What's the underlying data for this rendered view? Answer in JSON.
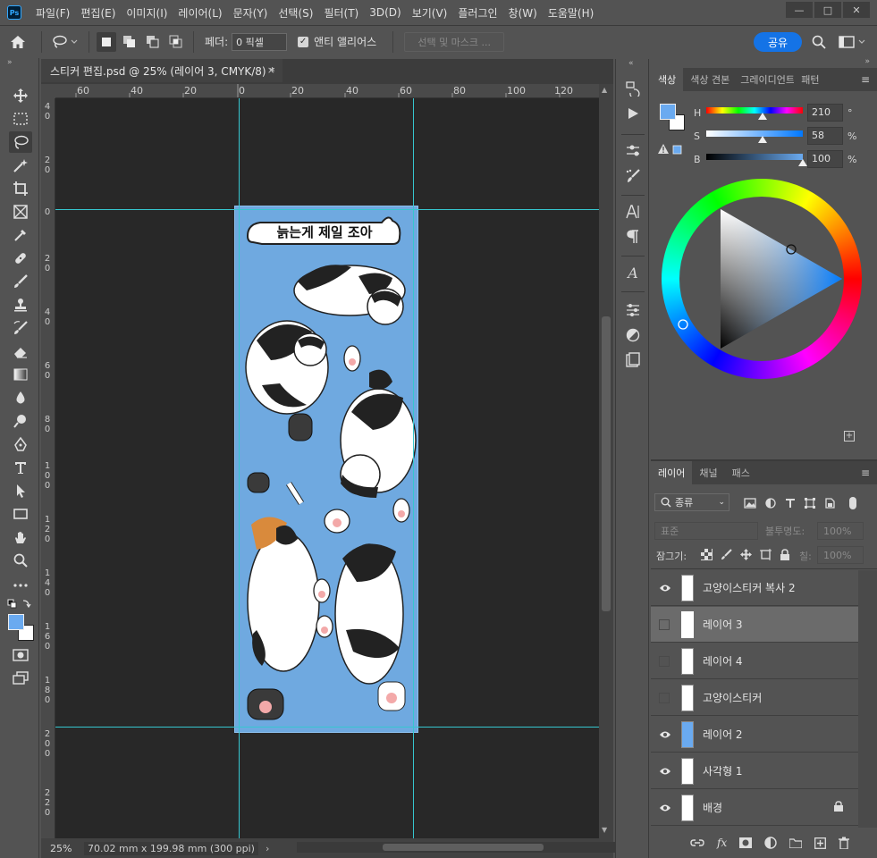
{
  "menu": {
    "logo": "Ps",
    "items": [
      "파일(F)",
      "편집(E)",
      "이미지(I)",
      "레이어(L)",
      "문자(Y)",
      "선택(S)",
      "필터(T)",
      "3D(D)",
      "보기(V)",
      "플러그인",
      "창(W)",
      "도움말(H)"
    ]
  },
  "window_controls": {
    "minimize": "—",
    "restore": "□",
    "close": "✕"
  },
  "options": {
    "feather_label": "페더:",
    "feather_value": "0 픽셀",
    "antialias_label": "앤티 앨리어스",
    "select_mask_label": "선택 및 마스크 ...",
    "share_label": "공유"
  },
  "document": {
    "tab_title": "스티커 편집.psd @ 25% (레이어 3, CMYK/8) *",
    "tab_close": "×",
    "sticker_title": "늙는게 제일 조아",
    "ruler_top": [
      "60",
      "40",
      "20",
      "0",
      "20",
      "40",
      "60",
      "80",
      "100",
      "120"
    ],
    "ruler_left": [
      "4 0",
      "2 0",
      "0",
      "2 0",
      "4 0",
      "6 0",
      "8 0",
      "1 0 0",
      "1 2 0",
      "1 4 0",
      "1 6 0",
      "1 8 0",
      "2 0 0",
      "2 2 0"
    ],
    "zoom": "25%",
    "size_info": "70.02 mm x 199.98 mm (300 ppi)"
  },
  "color_panel": {
    "tabs": [
      "색상",
      "색상 견본",
      "그레이디언트",
      "패턴"
    ],
    "h_label": "H",
    "h_value": "210",
    "h_unit": "°",
    "s_label": "S",
    "s_value": "58",
    "s_unit": "%",
    "b_label": "B",
    "b_value": "100",
    "b_unit": "%",
    "h_level": 0.58,
    "s_level": 0.58,
    "b_level": 1.0,
    "foreground": "#6aaaf0",
    "background": "#ffffff"
  },
  "layers_panel": {
    "tabs": [
      "레이어",
      "채널",
      "패스"
    ],
    "filter_label": "종류",
    "blend_mode": "표준",
    "opacity_label": "불투명도:",
    "opacity_value": "100%",
    "lock_label": "잠그기:",
    "fill_label": "칠:",
    "fill_value": "100%",
    "layers": [
      {
        "name": "고양이스티커 복사 2",
        "visible": true,
        "selected": false,
        "thumb": "#ffffff"
      },
      {
        "name": "레이어 3",
        "visible": false,
        "selected": true,
        "thumb": "#ffffff"
      },
      {
        "name": "레이어 4",
        "visible": false,
        "selected": false,
        "thumb": "#ffffff"
      },
      {
        "name": "고양이스티커",
        "visible": false,
        "selected": false,
        "thumb": "#ffffff"
      },
      {
        "name": "레이어 2",
        "visible": true,
        "selected": false,
        "thumb": "#6aaaf0"
      },
      {
        "name": "사각형 1",
        "visible": true,
        "selected": false,
        "thumb": "#ffffff"
      },
      {
        "name": "배경",
        "visible": true,
        "selected": false,
        "thumb": "#ffffff",
        "locked": true
      }
    ]
  }
}
